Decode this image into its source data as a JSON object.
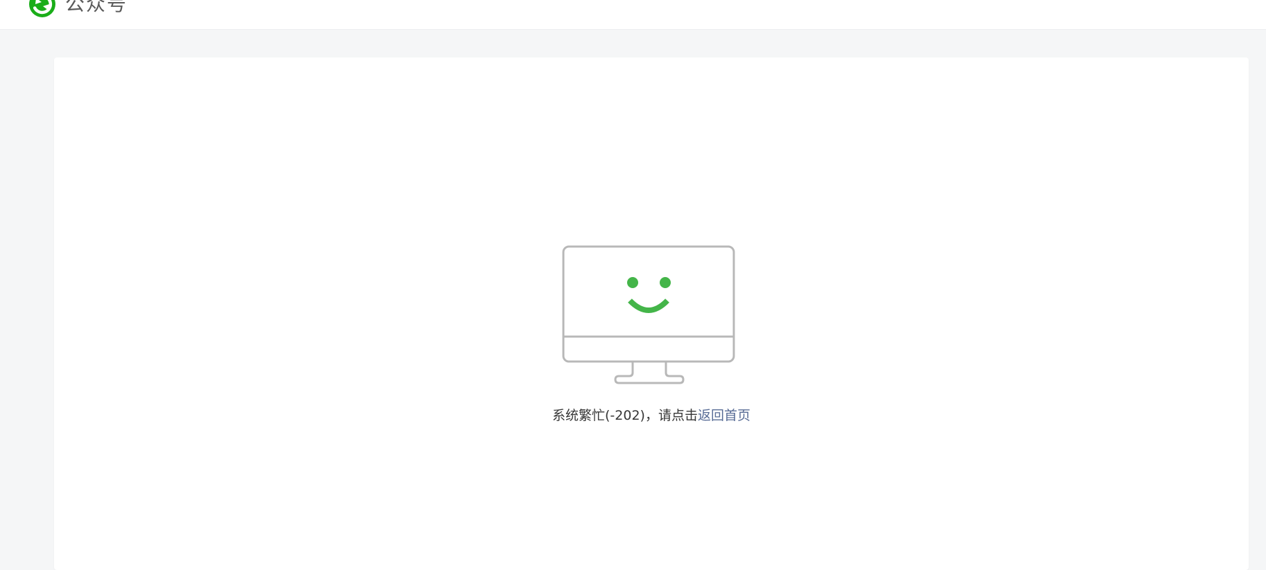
{
  "header": {
    "brand_text": "公众号",
    "logo_icon": "wechat-official-accounts-logo-icon",
    "logo_color": "#1aad19"
  },
  "error": {
    "illustration_icon": "smiling-monitor-icon",
    "message_prefix": "系统繁忙(-202)，请点击",
    "link_text": "返回首页",
    "accent_color": "#44b549",
    "link_color": "#576b95",
    "outline_color": "#b8b8b8"
  }
}
